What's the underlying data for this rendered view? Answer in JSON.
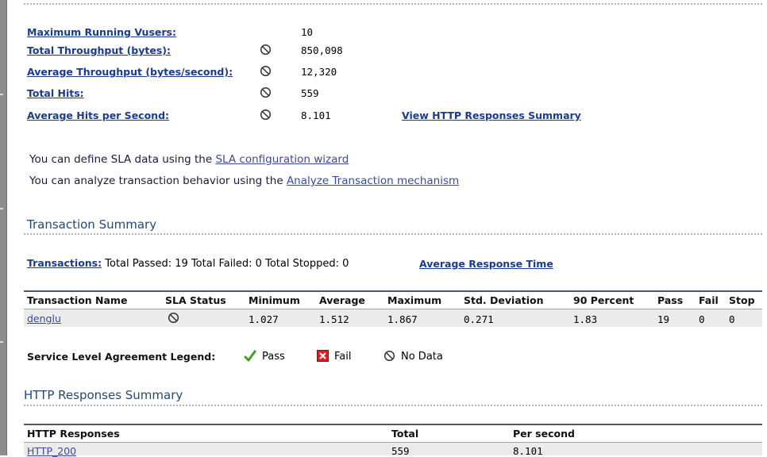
{
  "stats": [
    {
      "label": "Maximum Running Vusers:",
      "value": "10",
      "has_sla_icon": false
    },
    {
      "label": "Total Throughput (bytes):",
      "value": "850,098",
      "has_sla_icon": true
    },
    {
      "label": "Average Throughput (bytes/second):",
      "value": "12,320",
      "has_sla_icon": true
    },
    {
      "label": "Total Hits:",
      "value": "559",
      "has_sla_icon": true
    },
    {
      "label": "Average Hits per Second:",
      "value": "8.101",
      "has_sla_icon": true
    }
  ],
  "view_http_link": "View HTTP Responses Summary",
  "sla": {
    "line1_prefix": "You can define SLA data using the ",
    "line1_link": "SLA configuration wizard",
    "line2_prefix": "You can analyze transaction behavior using the ",
    "line2_link": "Analyze Transaction mechanism"
  },
  "transaction_summary": {
    "title": "Transaction Summary",
    "transactions_link": "Transactions:",
    "summary_text": " Total Passed: 19 Total Failed: 0 Total Stopped: 0",
    "avg_response_link": "Average Response Time",
    "columns": [
      "Transaction Name",
      "SLA Status",
      "Minimum",
      "Average",
      "Maximum",
      "Std. Deviation",
      "90 Percent",
      "Pass",
      "Fail",
      "Stop"
    ],
    "rows": [
      {
        "name": "denglu",
        "minimum": "1.027",
        "average": "1.512",
        "maximum": "1.867",
        "std_dev": "0.271",
        "p90": "1.83",
        "pass": "19",
        "fail": "0",
        "stop": "0"
      }
    ]
  },
  "legend": {
    "label": "Service Level Agreement Legend:",
    "pass": "Pass",
    "fail": "Fail",
    "no_data": "No Data"
  },
  "http_summary": {
    "title": "HTTP Responses Summary",
    "columns": [
      "HTTP Responses",
      "Total",
      "Per second"
    ],
    "rows": [
      {
        "response": "HTTP_200",
        "total": "559",
        "per_second": "8.101"
      }
    ]
  },
  "colors": {
    "link": "#1a3b8f",
    "section_title": "#234a73",
    "pass_green": "#3aa02a",
    "fail_red": "#d42020"
  }
}
